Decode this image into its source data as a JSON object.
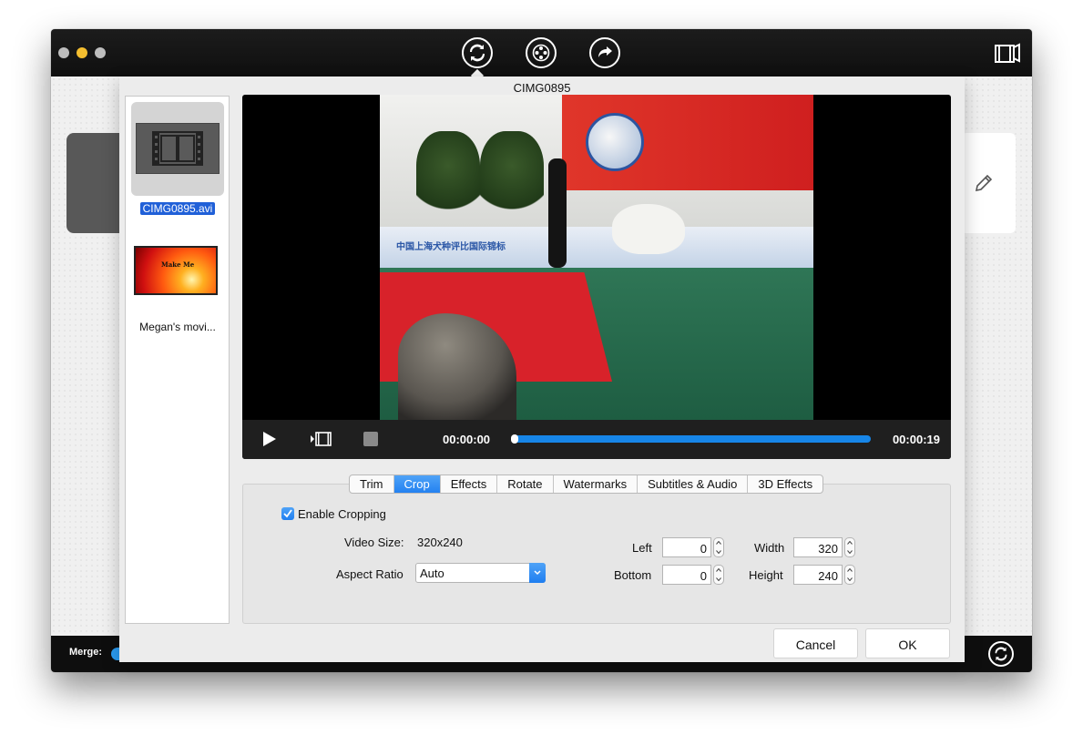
{
  "dialog": {
    "title": "CIMG0895"
  },
  "files": [
    {
      "name": "CIMG0895.avi",
      "selected": true,
      "thumbnail": "film-strip-icon"
    },
    {
      "name": "Megan's movi...",
      "selected": false,
      "thumbnail": "movie-thumbnail"
    }
  ],
  "thumbnail_text": "Make Me",
  "player": {
    "current_time": "00:00:00",
    "end_time": "00:00:19",
    "progress": 0,
    "video_board_text": "中国上海犬种评比国际锦标"
  },
  "tabs": [
    {
      "label": "Trim",
      "active": false
    },
    {
      "label": "Crop",
      "active": true
    },
    {
      "label": "Effects",
      "active": false
    },
    {
      "label": "Rotate",
      "active": false
    },
    {
      "label": "Watermarks",
      "active": false
    },
    {
      "label": "Subtitles & Audio",
      "active": false
    },
    {
      "label": "3D Effects",
      "active": false
    }
  ],
  "crop": {
    "enable_label": "Enable Cropping",
    "enabled": true,
    "video_size_label": "Video Size:",
    "video_size_value": "320x240",
    "aspect_ratio_label": "Aspect Ratio",
    "aspect_ratio_value": "Auto",
    "left_label": "Left",
    "left_value": "0",
    "bottom_label": "Bottom",
    "bottom_value": "0",
    "width_label": "Width",
    "width_value": "320",
    "height_label": "Height",
    "height_value": "240"
  },
  "buttons": {
    "cancel": "Cancel",
    "ok": "OK"
  },
  "bottombar": {
    "merge_label": "Merge:"
  },
  "colors": {
    "accent": "#1f7ef0",
    "titlebar": "#111111"
  }
}
